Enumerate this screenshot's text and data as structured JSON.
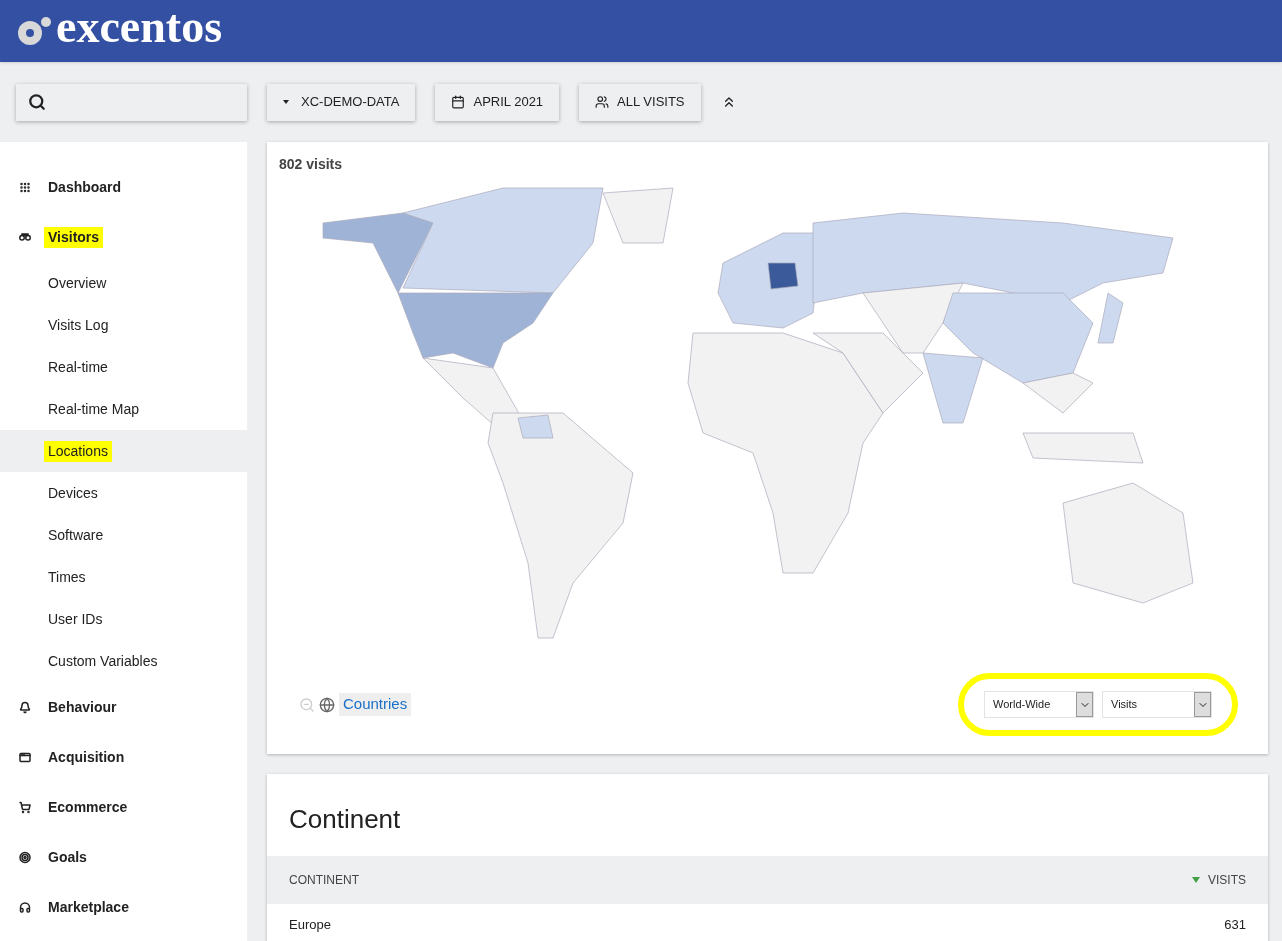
{
  "header": {
    "logo": "excentos"
  },
  "toolbar": {
    "buttons": [
      {
        "label": "XC-DEMO-DATA"
      },
      {
        "label": "APRIL 2021"
      },
      {
        "label": "ALL VISITS"
      }
    ]
  },
  "sidebar": {
    "items": [
      {
        "label": "Dashboard",
        "selected": false,
        "highlighted": false
      },
      {
        "label": "Visitors",
        "selected": false,
        "highlighted": true,
        "children": [
          {
            "label": "Overview",
            "selected": false,
            "highlighted": false
          },
          {
            "label": "Visits Log",
            "selected": false,
            "highlighted": false
          },
          {
            "label": "Real-time",
            "selected": false,
            "highlighted": false
          },
          {
            "label": "Real-time Map",
            "selected": false,
            "highlighted": false
          },
          {
            "label": "Locations",
            "selected": true,
            "highlighted": true
          },
          {
            "label": "Devices",
            "selected": false,
            "highlighted": false
          },
          {
            "label": "Software",
            "selected": false,
            "highlighted": false
          },
          {
            "label": "Times",
            "selected": false,
            "highlighted": false
          },
          {
            "label": "User IDs",
            "selected": false,
            "highlighted": false
          },
          {
            "label": "Custom Variables",
            "selected": false,
            "highlighted": false
          }
        ]
      },
      {
        "label": "Behaviour",
        "selected": false,
        "highlighted": false
      },
      {
        "label": "Acquisition",
        "selected": false,
        "highlighted": false
      },
      {
        "label": "Ecommerce",
        "selected": false,
        "highlighted": false
      },
      {
        "label": "Goals",
        "selected": false,
        "highlighted": false
      },
      {
        "label": "Marketplace",
        "selected": false,
        "highlighted": false
      }
    ]
  },
  "map_card": {
    "title": "802 visits",
    "level_link": "Countries",
    "controls_highlighted": true,
    "selects": [
      {
        "value": "World-Wide"
      },
      {
        "value": "Visits"
      }
    ]
  },
  "continent_table": {
    "title": "Continent",
    "columns": [
      {
        "label": "CONTINENT",
        "sorted": false
      },
      {
        "label": "VISITS",
        "sorted": true
      }
    ],
    "rows": [
      {
        "cells": [
          "Europe",
          "631"
        ]
      }
    ]
  }
}
